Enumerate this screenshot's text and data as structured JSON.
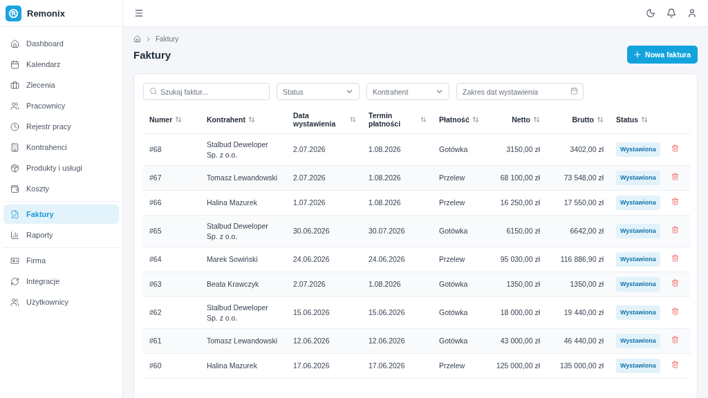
{
  "brand": {
    "name": "Remonix"
  },
  "sidebar": {
    "groups": [
      {
        "items": [
          {
            "label": "Dashboard",
            "selected": false
          },
          {
            "label": "Kalendarz",
            "selected": false
          },
          {
            "label": "Zlecenia",
            "selected": false
          },
          {
            "label": "Pracownicy",
            "selected": false
          },
          {
            "label": "Rejestr pracy",
            "selected": false
          },
          {
            "label": "Kontrahenci",
            "selected": false
          },
          {
            "label": "Produkty i usługi",
            "selected": false
          },
          {
            "label": "Koszty",
            "selected": false
          }
        ]
      },
      {
        "items": [
          {
            "label": "Faktury",
            "selected": true
          },
          {
            "label": "Raporty",
            "selected": false
          }
        ]
      },
      {
        "items": [
          {
            "label": "Firma",
            "selected": false
          },
          {
            "label": "Integracje",
            "selected": false
          },
          {
            "label": "Użytkownicy",
            "selected": false
          }
        ]
      }
    ]
  },
  "breadcrumb": [
    "Faktury"
  ],
  "page_title": "Faktury",
  "new_button": "Nowa faktura",
  "filters": {
    "search": {
      "placeholder": "Szukaj faktur..."
    },
    "status": {
      "placeholder": "Status"
    },
    "contractor": {
      "placeholder": "Kontrahent"
    },
    "date_range": {
      "placeholder": "Zakres dat wystawienia"
    }
  },
  "table": {
    "columns": [
      "Numer",
      "Kontrahent",
      "Data wystawienia",
      "Termin płatności",
      "Płatność",
      "Netto",
      "Brutto",
      "Status"
    ],
    "rows": [
      {
        "number": "#68",
        "contractor": "Stalbud Deweloper Sp. z o.o.",
        "issued": "2.07.2026",
        "due": "1.08.2026",
        "payment": "Gotówka",
        "net": "3150,00 zł",
        "gross": "3402,00 zł",
        "status": "Wystawiona"
      },
      {
        "number": "#67",
        "contractor": "Tomasz Lewandowski",
        "issued": "2.07.2026",
        "due": "1.08.2026",
        "payment": "Przelew",
        "net": "68 100,00 zł",
        "gross": "73 548,00 zł",
        "status": "Wystawiona"
      },
      {
        "number": "#66",
        "contractor": "Halina Mazurek",
        "issued": "1.07.2026",
        "due": "1.08.2026",
        "payment": "Przelew",
        "net": "16 250,00 zł",
        "gross": "17 550,00 zł",
        "status": "Wystawiona"
      },
      {
        "number": "#65",
        "contractor": "Stalbud Deweloper Sp. z o.o.",
        "issued": "30.06.2026",
        "due": "30.07.2026",
        "payment": "Gotówka",
        "net": "6150,00 zł",
        "gross": "6642,00 zł",
        "status": "Wystawiona"
      },
      {
        "number": "#64",
        "contractor": "Marek Sowiński",
        "issued": "24.06.2026",
        "due": "24.06.2026",
        "payment": "Przelew",
        "net": "95 030,00 zł",
        "gross": "116 886,90 zł",
        "status": "Wystawiona"
      },
      {
        "number": "#63",
        "contractor": "Beata Krawczyk",
        "issued": "2.07.2026",
        "due": "1.08.2026",
        "payment": "Gotówka",
        "net": "1350,00 zł",
        "gross": "1350,00 zł",
        "status": "Wystawiona"
      },
      {
        "number": "#62",
        "contractor": "Stalbud Deweloper Sp. z o.o.",
        "issued": "15.06.2026",
        "due": "15.06.2026",
        "payment": "Gotówka",
        "net": "18 000,00 zł",
        "gross": "19 440,00 zł",
        "status": "Wystawiona"
      },
      {
        "number": "#61",
        "contractor": "Tomasz Lewandowski",
        "issued": "12.06.2026",
        "due": "12.06.2026",
        "payment": "Gotówka",
        "net": "43 000,00 zł",
        "gross": "46 440,00 zł",
        "status": "Wystawiona"
      },
      {
        "number": "#60",
        "contractor": "Halina Mazurek",
        "issued": "17.06.2026",
        "due": "17.06.2026",
        "payment": "Przelew",
        "net": "125 000,00 zł",
        "gross": "135 000,00 zł",
        "status": "Wystawiona"
      }
    ]
  }
}
